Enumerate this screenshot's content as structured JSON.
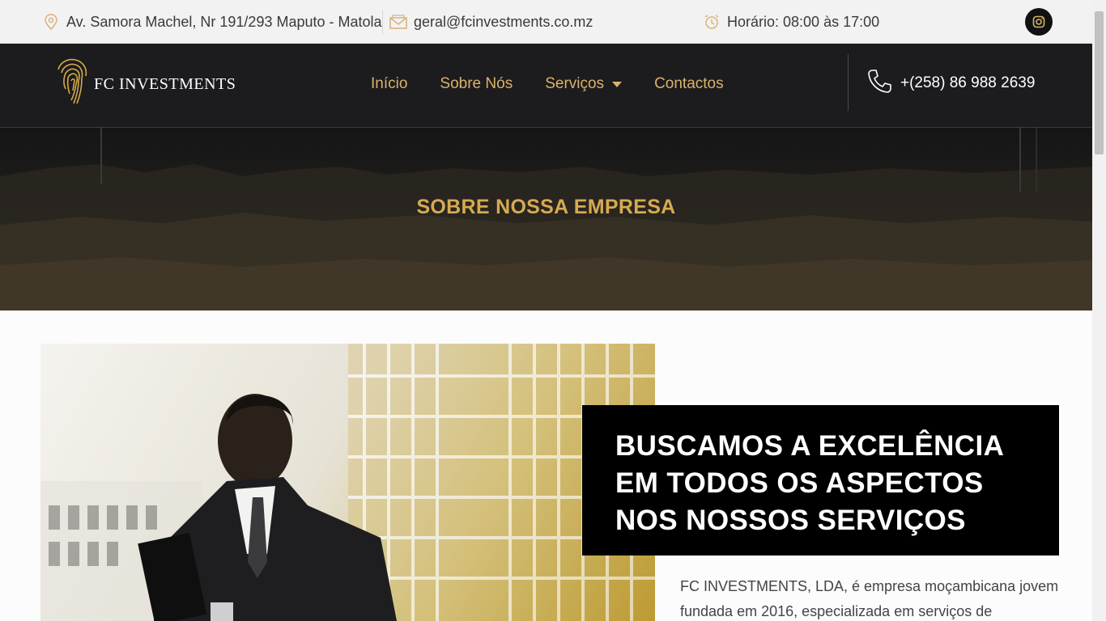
{
  "topbar": {
    "address": "Av. Samora Machel, Nr 191/293 Maputo - Matola",
    "email": "geral@fcinvestments.co.mz",
    "hours": "Horário: 08:00 às 17:00",
    "icons": {
      "address": "map-pin-icon",
      "email": "envelope-icon",
      "hours": "alarm-clock-icon",
      "social": "instagram-icon"
    }
  },
  "header": {
    "logo_text": "FC INVESTMENTS",
    "nav": [
      {
        "label": "Início"
      },
      {
        "label": "Sobre Nós"
      },
      {
        "label": "Serviços"
      },
      {
        "label": "Contactos"
      }
    ],
    "phone": "+(258) 86 988 2639"
  },
  "hero": {
    "title": "SOBRE NOSSA EMPRESA"
  },
  "about": {
    "headline": "BUSCAMOS A EXCELÊNCIA EM TODOS OS ASPECTOS NOS NOSSOS SERVIÇOS",
    "description": "FC INVESTMENTS, LDA, é empresa moçambicana jovem fundada em 2016, especializada em serviços de"
  },
  "colors": {
    "gold": "#d9b36a",
    "dark": "#1c1c1e",
    "black": "#000000"
  }
}
